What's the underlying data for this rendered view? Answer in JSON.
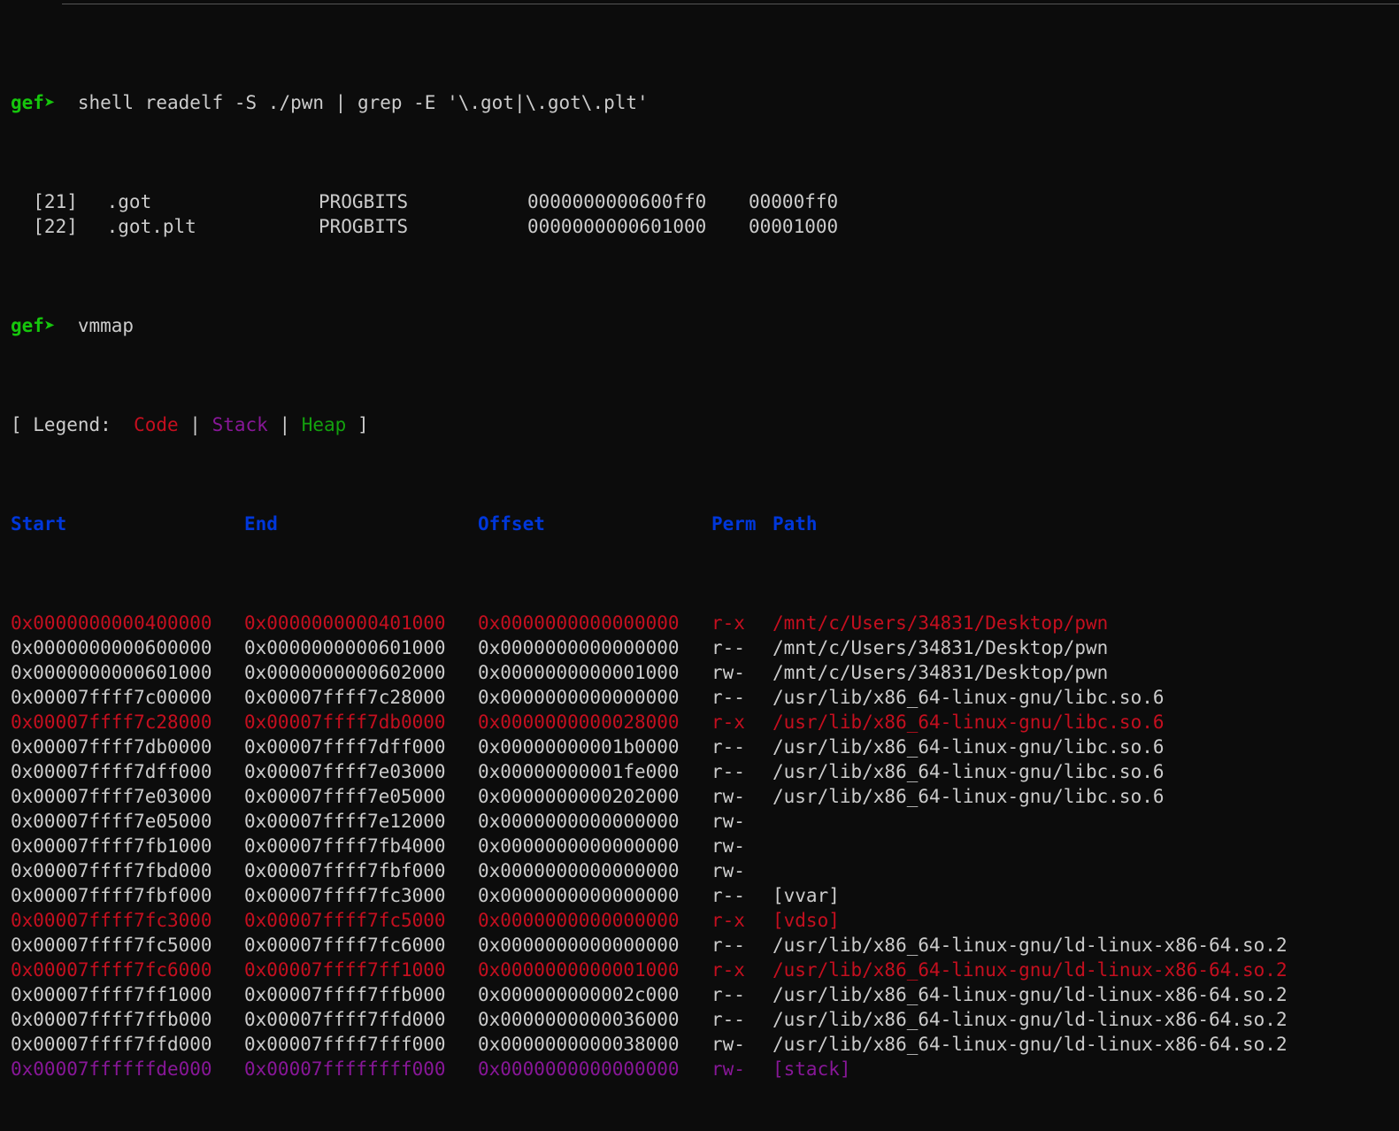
{
  "prompt": "gef➤",
  "commands": {
    "readelf": "  shell readelf -S ./pwn | grep -E '\\.got|\\.got\\.plt'",
    "vmmap": "  vmmap"
  },
  "sections": [
    {
      "index": "  [21]",
      "name": " .got",
      "type": "PROGBITS",
      "address": "0000000000600ff0",
      "offset": "00000ff0"
    },
    {
      "index": "  [22]",
      "name": " .got.plt",
      "type": "PROGBITS",
      "address": "0000000000601000",
      "offset": "00001000"
    }
  ],
  "legend": {
    "prefix": "[ Legend:  ",
    "code": "Code",
    "sep1": " | ",
    "stack": "Stack",
    "sep2": " | ",
    "heap": "Heap",
    "suffix": " ]"
  },
  "colors": {
    "prompt": "#16c60c",
    "header": "#0037da",
    "code": "#c50f1f",
    "stack": "#881798",
    "heap": "#13a10e",
    "default": "#cccccc",
    "background": "#0c0c0c"
  },
  "vmmap_headers": {
    "start": "Start",
    "end": "End",
    "offset": "Offset",
    "perm": "Perm",
    "path": "Path"
  },
  "vmmap_rows": [
    {
      "start": "0x0000000000400000",
      "end": "0x0000000000401000",
      "offset": "0x0000000000000000",
      "perm": "r-x",
      "path": "/mnt/c/Users/34831/Desktop/pwn",
      "kind": "code"
    },
    {
      "start": "0x0000000000600000",
      "end": "0x0000000000601000",
      "offset": "0x0000000000000000",
      "perm": "r--",
      "path": "/mnt/c/Users/34831/Desktop/pwn",
      "kind": "default"
    },
    {
      "start": "0x0000000000601000",
      "end": "0x0000000000602000",
      "offset": "0x0000000000001000",
      "perm": "rw-",
      "path": "/mnt/c/Users/34831/Desktop/pwn",
      "kind": "default"
    },
    {
      "start": "0x00007ffff7c00000",
      "end": "0x00007ffff7c28000",
      "offset": "0x0000000000000000",
      "perm": "r--",
      "path": "/usr/lib/x86_64-linux-gnu/libc.so.6",
      "kind": "default"
    },
    {
      "start": "0x00007ffff7c28000",
      "end": "0x00007ffff7db0000",
      "offset": "0x0000000000028000",
      "perm": "r-x",
      "path": "/usr/lib/x86_64-linux-gnu/libc.so.6",
      "kind": "code"
    },
    {
      "start": "0x00007ffff7db0000",
      "end": "0x00007ffff7dff000",
      "offset": "0x00000000001b0000",
      "perm": "r--",
      "path": "/usr/lib/x86_64-linux-gnu/libc.so.6",
      "kind": "default"
    },
    {
      "start": "0x00007ffff7dff000",
      "end": "0x00007ffff7e03000",
      "offset": "0x00000000001fe000",
      "perm": "r--",
      "path": "/usr/lib/x86_64-linux-gnu/libc.so.6",
      "kind": "default"
    },
    {
      "start": "0x00007ffff7e03000",
      "end": "0x00007ffff7e05000",
      "offset": "0x0000000000202000",
      "perm": "rw-",
      "path": "/usr/lib/x86_64-linux-gnu/libc.so.6",
      "kind": "default"
    },
    {
      "start": "0x00007ffff7e05000",
      "end": "0x00007ffff7e12000",
      "offset": "0x0000000000000000",
      "perm": "rw-",
      "path": "",
      "kind": "default"
    },
    {
      "start": "0x00007ffff7fb1000",
      "end": "0x00007ffff7fb4000",
      "offset": "0x0000000000000000",
      "perm": "rw-",
      "path": "",
      "kind": "default"
    },
    {
      "start": "0x00007ffff7fbd000",
      "end": "0x00007ffff7fbf000",
      "offset": "0x0000000000000000",
      "perm": "rw-",
      "path": "",
      "kind": "default"
    },
    {
      "start": "0x00007ffff7fbf000",
      "end": "0x00007ffff7fc3000",
      "offset": "0x0000000000000000",
      "perm": "r--",
      "path": "[vvar]",
      "kind": "default"
    },
    {
      "start": "0x00007ffff7fc3000",
      "end": "0x00007ffff7fc5000",
      "offset": "0x0000000000000000",
      "perm": "r-x",
      "path": "[vdso]",
      "kind": "code"
    },
    {
      "start": "0x00007ffff7fc5000",
      "end": "0x00007ffff7fc6000",
      "offset": "0x0000000000000000",
      "perm": "r--",
      "path": "/usr/lib/x86_64-linux-gnu/ld-linux-x86-64.so.2",
      "kind": "default"
    },
    {
      "start": "0x00007ffff7fc6000",
      "end": "0x00007ffff7ff1000",
      "offset": "0x0000000000001000",
      "perm": "r-x",
      "path": "/usr/lib/x86_64-linux-gnu/ld-linux-x86-64.so.2",
      "kind": "code"
    },
    {
      "start": "0x00007ffff7ff1000",
      "end": "0x00007ffff7ffb000",
      "offset": "0x000000000002c000",
      "perm": "r--",
      "path": "/usr/lib/x86_64-linux-gnu/ld-linux-x86-64.so.2",
      "kind": "default"
    },
    {
      "start": "0x00007ffff7ffb000",
      "end": "0x00007ffff7ffd000",
      "offset": "0x0000000000036000",
      "perm": "r--",
      "path": "/usr/lib/x86_64-linux-gnu/ld-linux-x86-64.so.2",
      "kind": "default"
    },
    {
      "start": "0x00007ffff7ffd000",
      "end": "0x00007ffff7fff000",
      "offset": "0x0000000000038000",
      "perm": "rw-",
      "path": "/usr/lib/x86_64-linux-gnu/ld-linux-x86-64.so.2",
      "kind": "default"
    },
    {
      "start": "0x00007ffffffde000",
      "end": "0x00007ffffffff000",
      "offset": "0x0000000000000000",
      "perm": "rw-",
      "path": "[stack]",
      "kind": "stack"
    }
  ]
}
